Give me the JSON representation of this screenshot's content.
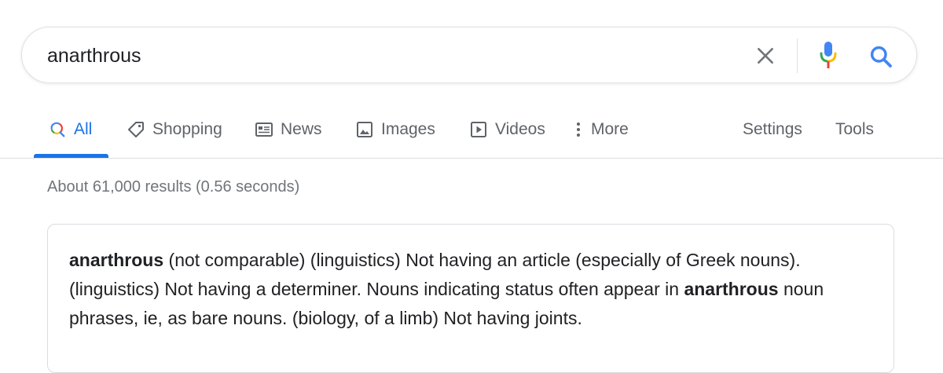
{
  "search": {
    "query": "anarthrous"
  },
  "icons": {
    "clear": "close-icon",
    "voice": "microphone-icon",
    "search": "magnifier-icon"
  },
  "colors": {
    "accent": "#1a73e8",
    "tab_text": "#5f6368",
    "stats_text": "#70757a",
    "mic_blue": "#4285f4",
    "mic_red": "#ea4335",
    "mic_yellow": "#fbbc04",
    "mic_green": "#34a853"
  },
  "tabs": {
    "all": "All",
    "shopping": "Shopping",
    "news": "News",
    "images": "Images",
    "videos": "Videos",
    "more": "More",
    "settings": "Settings",
    "tools": "Tools"
  },
  "results": {
    "stats": "About 61,000 results (0.56 seconds)"
  },
  "definition": {
    "term": "anarthrous",
    "text_1": " (not comparable) (linguistics) Not having an article (especially of Greek nouns). (linguistics) Not having a determiner. Nouns indicating status often appear in ",
    "term_2": "anarthrous",
    "text_2": " noun phrases, ie, as bare nouns. (biology, of a limb) Not having joints."
  }
}
